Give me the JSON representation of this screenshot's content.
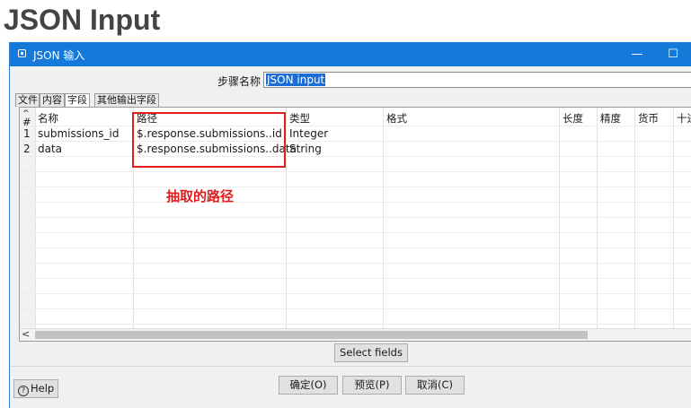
{
  "page_heading": "JSON Input",
  "window": {
    "title": "JSON 输入",
    "minimize_glyph": "—",
    "maximize_glyph": "☐"
  },
  "step_name": {
    "label": "步骤名称",
    "value": "JSON input"
  },
  "tabs": [
    {
      "label": "文件",
      "active": false
    },
    {
      "label": "内容",
      "active": false
    },
    {
      "label": "字段",
      "active": true
    },
    {
      "label": "其他输出字段",
      "active": false
    }
  ],
  "grid": {
    "columns": [
      "#",
      "名称",
      "路径",
      "类型",
      "格式",
      "长度",
      "精度",
      "货币",
      "十进制"
    ],
    "rows": [
      {
        "num": "1",
        "name": "submissions_id",
        "path": "$.response.submissions..id",
        "type": "Integer"
      },
      {
        "num": "2",
        "name": "data",
        "path": "$.response.submissions..data",
        "type": "String"
      }
    ]
  },
  "annotation": {
    "text": "抽取的路径",
    "color": "#e01e1e"
  },
  "buttons": {
    "select_fields": "Select fields",
    "ok": "确定(O)",
    "preview": "预览(P)",
    "cancel": "取消(C)",
    "help": "Help"
  },
  "icons": {
    "app": "step-icon",
    "help": "help-circle-icon",
    "scroll_left": "chevron-left-icon"
  },
  "colors": {
    "titlebar": "#1479d9",
    "selection": "#1c6cd6",
    "highlight": "#e01e1e"
  }
}
